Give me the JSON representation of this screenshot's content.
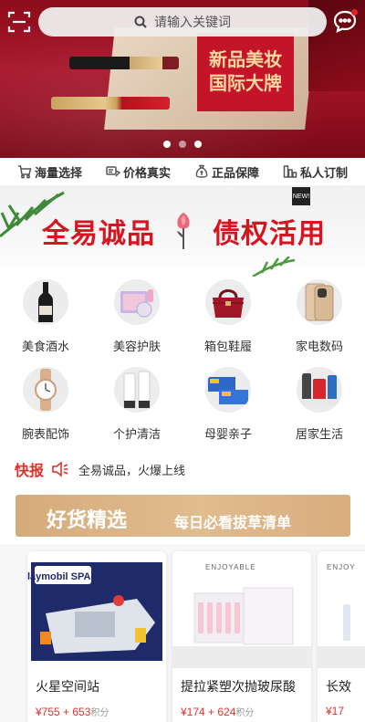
{
  "search": {
    "placeholder": "请输入关键词"
  },
  "hero_banner": {
    "headline_line1": "新品美妆",
    "headline_line2": "国际大牌",
    "slides": 3,
    "active_slide": 1
  },
  "features": [
    {
      "label": "海量选择",
      "icon": "cart-icon"
    },
    {
      "label": "价格真实",
      "icon": "price-tag-icon"
    },
    {
      "label": "正品保障",
      "icon": "money-bag-icon"
    },
    {
      "label": "私人订制",
      "icon": "bar-chart-icon"
    }
  ],
  "promo_banner": {
    "title_left": "全易诚品",
    "title_right": "债权活用",
    "badge": "NEW!"
  },
  "categories": [
    {
      "label": "美食酒水",
      "icon": "wine-bottle-icon"
    },
    {
      "label": "美容护肤",
      "icon": "cosmetics-icon"
    },
    {
      "label": "箱包鞋履",
      "icon": "handbag-icon"
    },
    {
      "label": "家电数码",
      "icon": "smartphone-icon"
    },
    {
      "label": "腕表配饰",
      "icon": "wristwatch-icon"
    },
    {
      "label": "个护清洁",
      "icon": "toiletries-icon"
    },
    {
      "label": "母婴亲子",
      "icon": "toy-box-icon"
    },
    {
      "label": "居家生活",
      "icon": "household-icon"
    }
  ],
  "news": {
    "tag": "快报",
    "text": "全易诚品，火爆上线"
  },
  "goods_section": {
    "title": "好货精选",
    "subtitle": "每日必看拔草清单"
  },
  "products": [
    {
      "name": "火星空间站",
      "price": "¥755 + 653",
      "points_unit": "积分",
      "brand": "playmobil SPACE"
    },
    {
      "name": "提拉紧塑次抛玻尿酸",
      "price": "¥174 + 624",
      "points_unit": "积分",
      "brand": "ENJOYABLE"
    },
    {
      "name": "长效",
      "price": "¥17",
      "points_unit": "",
      "brand": "ENJOY"
    }
  ],
  "colors": {
    "brand_red": "#d9131f",
    "accent_gold": "#d6ab7b",
    "news_red": "#e0322a"
  }
}
